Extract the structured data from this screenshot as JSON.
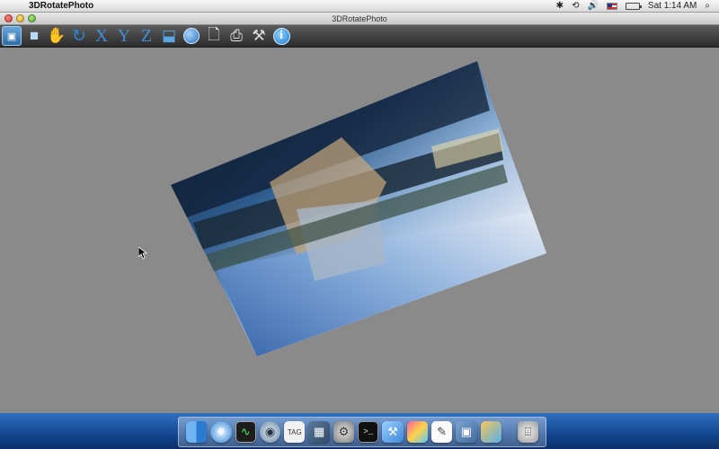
{
  "menubar": {
    "app_name": "3DRotatePhoto",
    "clock": "Sat 1:14 AM",
    "status_icons": [
      "bluetooth-icon",
      "time-machine-icon",
      "volume-icon",
      "flag-icon",
      "battery-icon",
      "spotlight-icon"
    ]
  },
  "window": {
    "title": "3DRotatePhoto"
  },
  "toolbar": {
    "buttons": [
      {
        "name": "open-photo-button",
        "icon": "open-photo-icon"
      },
      {
        "name": "save-button",
        "icon": "floppy-disk-icon"
      },
      {
        "name": "pan-hand-button",
        "icon": "hand-icon"
      },
      {
        "name": "rotate-button",
        "icon": "rotate-arrow-icon"
      },
      {
        "name": "rotate-x-button",
        "label": "X"
      },
      {
        "name": "rotate-y-button",
        "label": "Y"
      },
      {
        "name": "rotate-z-button",
        "label": "Z"
      },
      {
        "name": "layers-button",
        "icon": "layers-icon"
      },
      {
        "name": "globe-button",
        "icon": "globe-icon"
      },
      {
        "name": "document-button",
        "icon": "document-icon"
      },
      {
        "name": "print-button",
        "icon": "printer-icon"
      },
      {
        "name": "tools-button",
        "icon": "wrench-screwdriver-icon"
      },
      {
        "name": "info-button",
        "label": "i"
      }
    ]
  },
  "dock": {
    "items": [
      "finder",
      "safari",
      "activity-monitor",
      "network-utility",
      "tag-app",
      "mosaic-app",
      "system-preferences",
      "terminal",
      "xcode",
      "paint-app",
      "textedit",
      "preview",
      "misc-app",
      "trash"
    ],
    "terminal_glyph": ">_",
    "tag_glyph": "TAG"
  },
  "colors": {
    "canvas_bg": "#8a8a8a",
    "toolbar_axis": "#3f8ed8",
    "dock_blue": "#2f6fc0"
  }
}
